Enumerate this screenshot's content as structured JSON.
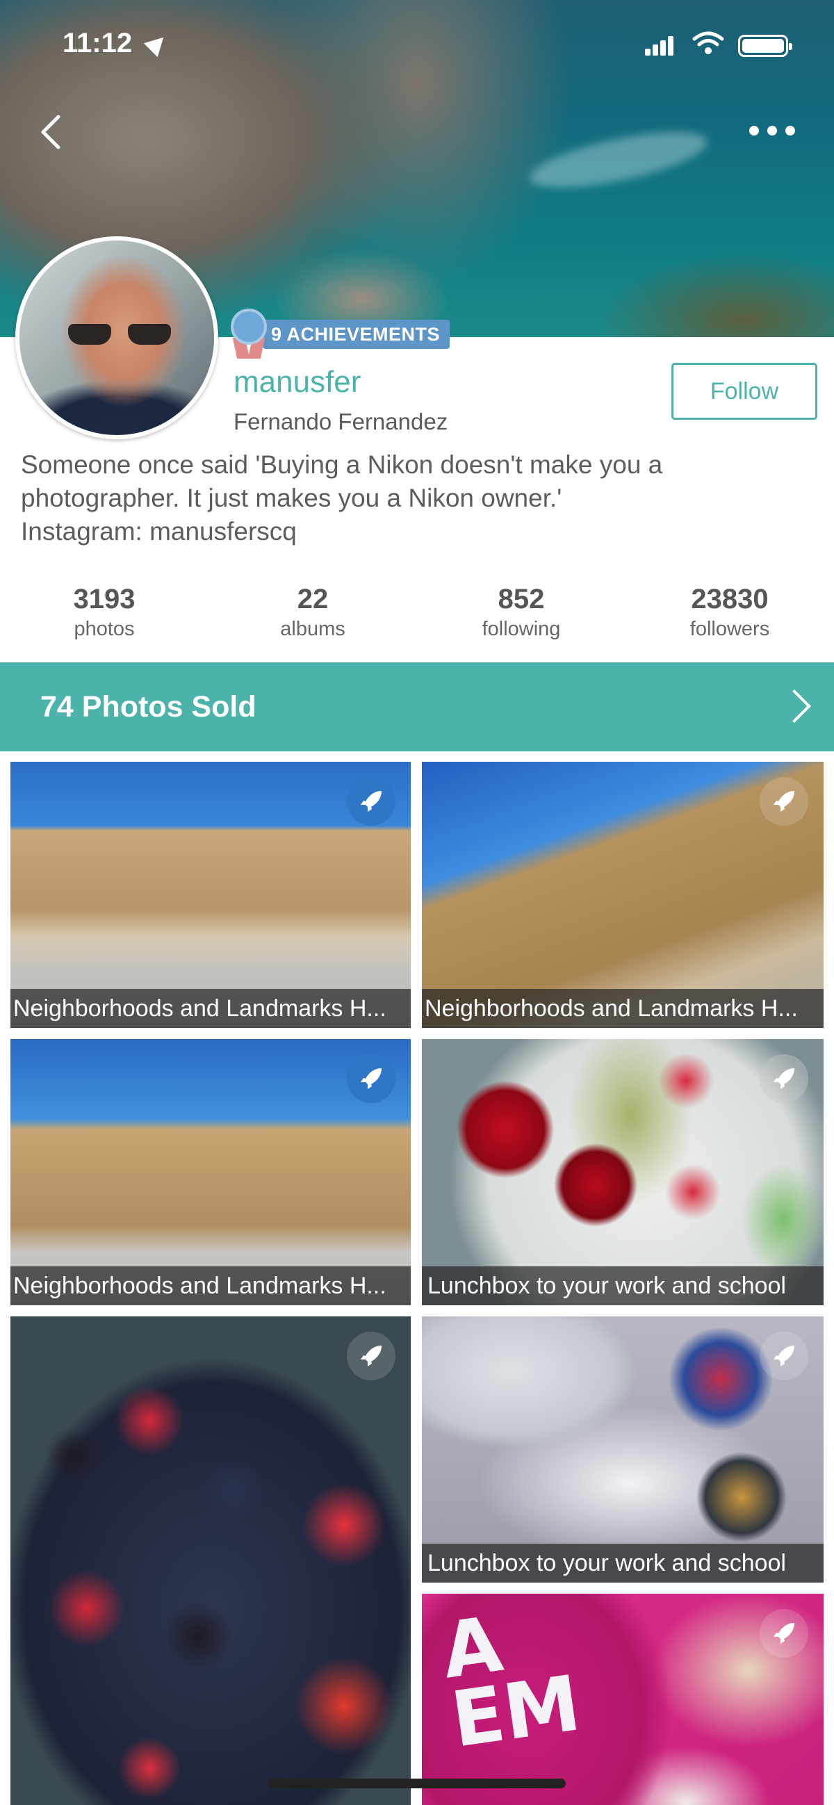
{
  "status_bar": {
    "time": "11:12"
  },
  "profile": {
    "achievements": "9 ACHIEVEMENTS",
    "username": "manusfer",
    "full_name": "Fernando Fernandez",
    "follow_label": "Follow",
    "bio_lines": [
      "Someone once said 'Buying a Nikon doesn't make you a",
      "photographer. It just makes you a Nikon owner.'",
      "Instagram: manusferscq"
    ]
  },
  "stats": [
    {
      "value": "3193",
      "label": "photos"
    },
    {
      "value": "22",
      "label": "albums"
    },
    {
      "value": "852",
      "label": "following"
    },
    {
      "value": "23830",
      "label": "followers"
    }
  ],
  "sold_banner": {
    "label": "74 Photos Sold"
  },
  "grid": [
    {
      "caption": "Neighborhoods and Landmarks H...",
      "boosted": true
    },
    {
      "caption": "Neighborhoods and Landmarks H...",
      "boosted": false
    },
    {
      "caption": "Neighborhoods and Landmarks H...",
      "boosted": true
    },
    {
      "caption": "Lunchbox to your work and school",
      "boosted": false
    },
    {
      "caption": "",
      "boosted": false
    },
    {
      "caption": "Lunchbox to your work and school",
      "boosted": false
    },
    {
      "caption": "",
      "boosted": false
    }
  ],
  "icons": {
    "back": "chevron-left-icon",
    "more": "more-dots-icon",
    "boost": "rocket-icon",
    "achievement": "medal-icon",
    "sold_chevron": "chevron-right-icon"
  },
  "colors": {
    "accent": "#4cb3aa",
    "achievement_badge": "#5e95c9",
    "boost_active": "#2f76c8"
  }
}
